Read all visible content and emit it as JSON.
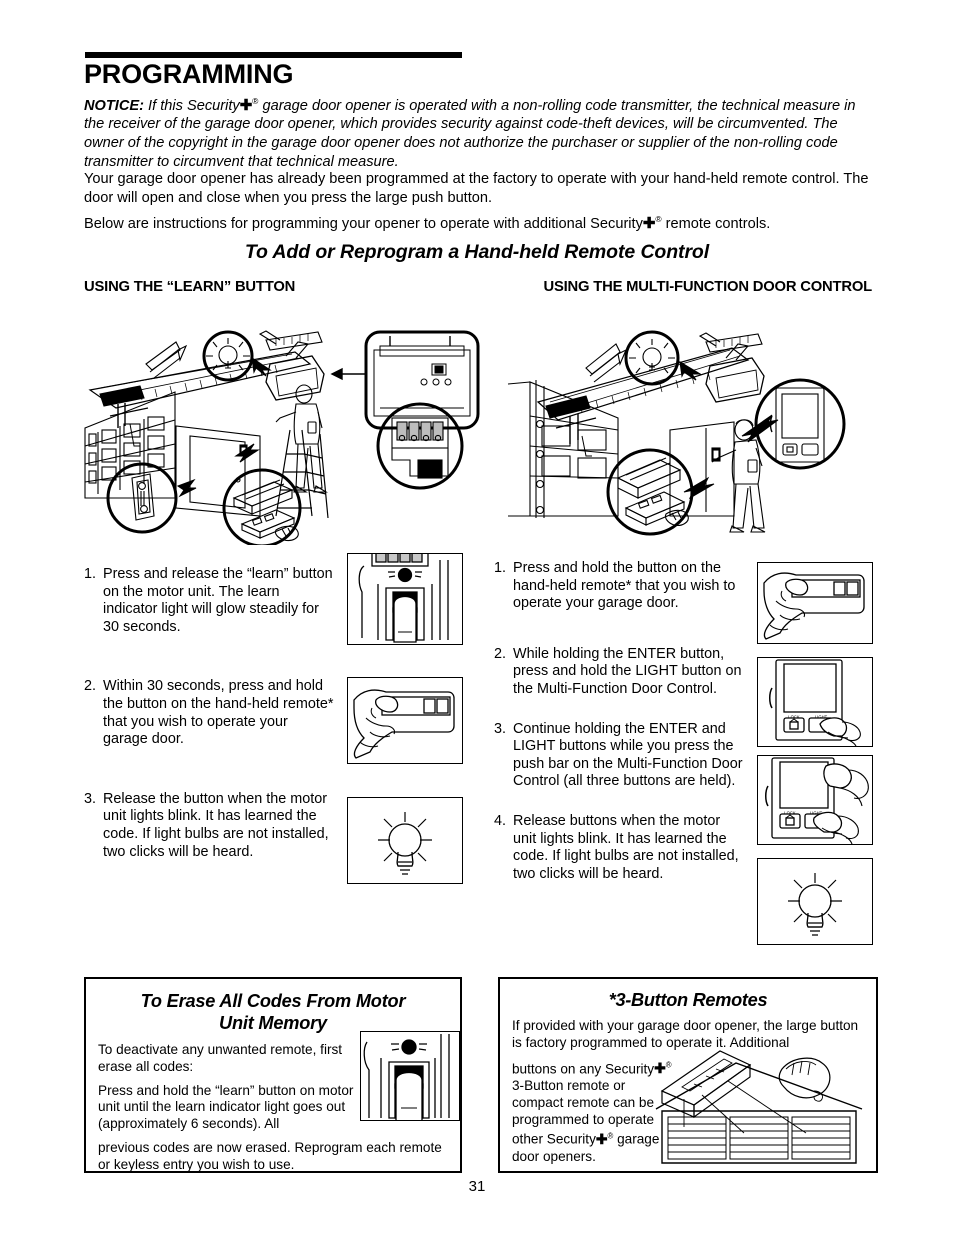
{
  "page": {
    "title": "PROGRAMMING",
    "page_number": "31"
  },
  "notice": {
    "label": "NOTICE:",
    "text_1": " If this Security",
    "text_2": " garage door opener is operated with a non-rolling code transmitter, the technical measure in the receiver of the garage door opener, which provides security against code-theft devices, will be circumvented. The owner of the copyright in the garage door opener does not authorize the purchaser or supplier of the non-rolling code transmitter to circumvent that technical measure."
  },
  "intro": {
    "paragraph_1": "Your garage door opener has already been programmed at the factory to operate with your hand-held remote control. The door will open and close when you press the large push button.",
    "paragraph_2_pre": "Below are instructions for programming your opener to operate with additional Security",
    "paragraph_2_post": " remote controls."
  },
  "section": {
    "heading": "To Add or Reprogram a Hand-held Remote Control",
    "column_left_heading": "USING THE “LEARN” BUTTON",
    "column_right_heading": "USING THE MULTI-FUNCTION DOOR CONTROL"
  },
  "steps_learn_button": [
    {
      "num": "1.",
      "text": "Press and release the “learn” button on the motor unit. The learn indicator light will glow steadily for 30 seconds.",
      "thumb": "motor-unit-learn-button-press"
    },
    {
      "num": "2.",
      "text": "Within 30 seconds, press and hold the button on the hand-held remote* that you wish to operate your garage door.",
      "thumb": "hand-pressing-remote"
    },
    {
      "num": "3.",
      "text": "Release the button when the motor unit lights blink. It has learned the code. If light bulbs are not installed, two clicks will be heard.",
      "thumb": "light-bulb-blinking"
    }
  ],
  "steps_door_control": [
    {
      "num": "1.",
      "text": "Press and hold the button on the hand-held remote* that you wish to operate your garage door.",
      "thumb": "hand-pressing-remote"
    },
    {
      "num": "2.",
      "text": "While holding the ENTER button, press and hold the LIGHT button on the Multi-Function Door Control.",
      "thumb": "door-control-light-button"
    },
    {
      "num": "3.",
      "text": "Continue holding the ENTER and LIGHT buttons while you press the push bar on the Multi-Function Door Control (all three buttons are held).",
      "thumb": "door-control-push-bar"
    },
    {
      "num": "4.",
      "text": "Release buttons when the motor unit lights blink. It has learned the code. If light bulbs are not installed, two clicks will be heard.",
      "thumb": "light-bulb-blinking"
    }
  ],
  "erase_box": {
    "title_line_1": "To Erase All Codes From Motor",
    "title_line_2": "Unit Memory",
    "paragraph_1": "To deactivate any unwanted remote, first erase all codes:",
    "paragraph_2": "Press and hold the “learn” button on motor unit until the learn indicator light goes out (approximately 6 seconds). All",
    "paragraph_3": "previous codes are now erased. Reprogram each remote or keyless entry you wish to use."
  },
  "three_button_box": {
    "title": "*3-Button Remotes",
    "paragraph_1": "If provided with your garage door opener, the large button is factory programmed to operate it. Additional",
    "paragraph_2_a": "buttons on any Security",
    "paragraph_2_b": " 3-Button remote or compact remote can be programmed to operate other Security",
    "paragraph_2_c": " garage door openers."
  },
  "door_control_labels": {
    "lock": "LOCK",
    "light": "LIGHT"
  },
  "symbols": {
    "security_cross": "✚",
    "registered": "®"
  },
  "colors": {
    "ink": "#000000",
    "paper": "#ffffff",
    "shade_light": "#d9d9d9",
    "shade_mid": "#9a9a9a"
  }
}
